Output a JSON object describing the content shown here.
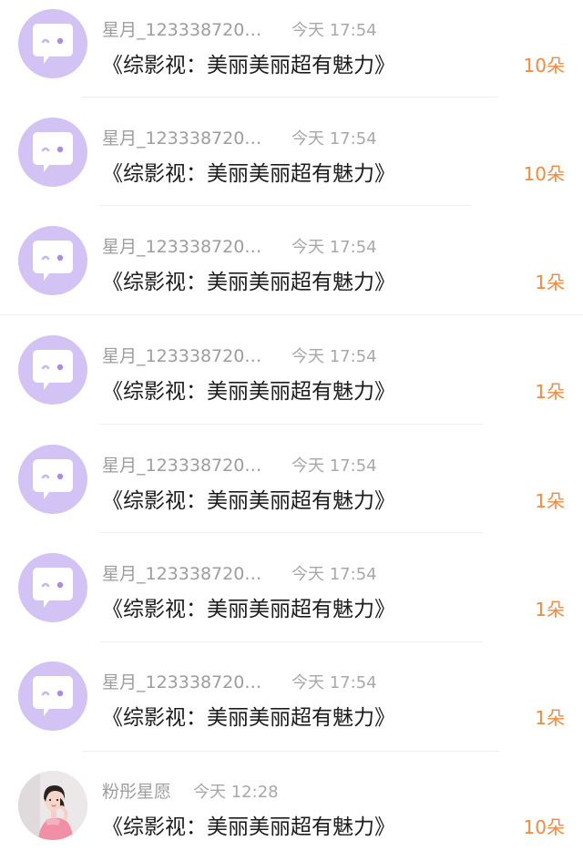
{
  "items": [
    {
      "user": "星月_123338720…",
      "time": "今天 17:54",
      "title": "《综影视：美丽美丽超有魅力》",
      "count": "10朵",
      "avatar_icon": "chat-bubble-wink-icon"
    },
    {
      "user": "星月_123338720…",
      "time": "今天 17:54",
      "title": "《综影视：美丽美丽超有魅力》",
      "count": "10朵",
      "avatar_icon": "chat-bubble-wink-icon"
    },
    {
      "user": "星月_123338720…",
      "time": "今天 17:54",
      "title": "《综影视：美丽美丽超有魅力》",
      "count": "1朵",
      "avatar_icon": "chat-bubble-wink-icon"
    },
    {
      "user": "星月_123338720…",
      "time": "今天 17:54",
      "title": "《综影视：美丽美丽超有魅力》",
      "count": "1朵",
      "avatar_icon": "chat-bubble-wink-icon"
    },
    {
      "user": "星月_123338720…",
      "time": "今天 17:54",
      "title": "《综影视：美丽美丽超有魅力》",
      "count": "1朵",
      "avatar_icon": "chat-bubble-wink-icon"
    },
    {
      "user": "星月_123338720…",
      "time": "今天 17:54",
      "title": "《综影视：美丽美丽超有魅力》",
      "count": "1朵",
      "avatar_icon": "chat-bubble-wink-icon"
    },
    {
      "user": "星月_123338720…",
      "time": "今天 17:54",
      "title": "《综影视：美丽美丽超有魅力》",
      "count": "1朵",
      "avatar_icon": "chat-bubble-wink-icon"
    },
    {
      "user": "粉彤星愿",
      "time": "今天 12:28",
      "title": "《综影视：美丽美丽超有魅力》",
      "count": "10朵",
      "avatar_icon": "user-photo-avatar"
    }
  ],
  "colors": {
    "avatar_bg": "#d3c3f4",
    "count": "#f08a3c",
    "username": "#9d9d9d",
    "title": "#1c1c1c"
  }
}
